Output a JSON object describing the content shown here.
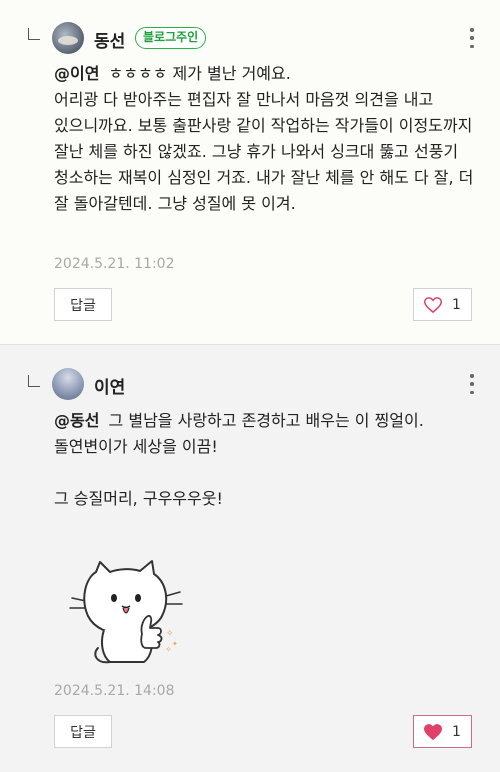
{
  "replies": [
    {
      "author": "동선",
      "badge": "블로그주인",
      "mention": "@이연",
      "text": "ㅎㅎㅎㅎ 제가 별난 거예요.\n어리광 다 받아주는 편집자 잘 만나서 마음껏 의견을 내고 있으니까요. 보통 출판사랑 같이 작업하는 작가들이 이정도까지 잘난 체를 하진 않겠죠. 그냥 휴가 나와서 싱크대 뚫고 선풍기 청소하는 재복이 심정인 거죠. 내가 잘난 체를 안 해도 다 잘, 더 잘 돌아갈텐데. 그냥 성질에 못 이겨.",
      "date": "2024.5.21. 11:02",
      "reply_label": "답글",
      "like_count": "1",
      "liked": false
    },
    {
      "author": "이연",
      "mention": "@동선",
      "text": "그 별남을 사랑하고 존경하고 배우는 이 찡얼이.\n돌연변이가 세상을 이끔!\n\n그 승질머리, 구우우우웃!",
      "sticker": "cat-thumbs-up-sticker",
      "date": "2024.5.21. 14:08",
      "reply_label": "답글",
      "like_count": "1",
      "liked": true
    }
  ],
  "colors": {
    "badge_green": "#1ea03e",
    "heart_pink": "#e0416b",
    "date_gray": "#a8a8a8"
  }
}
